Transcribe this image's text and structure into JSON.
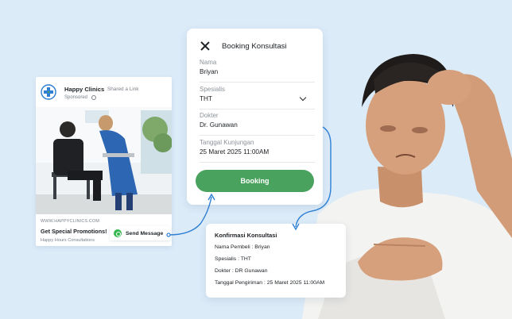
{
  "colors": {
    "background": "#dcebf8",
    "accent_green": "#4aa25f",
    "connector_blue": "#2f7fd4",
    "whatsapp_green": "#35b84f"
  },
  "ad": {
    "brand": "Happy Clinics",
    "shared": "Shared a Link",
    "sponsored": "Sponsored",
    "logo_icon": "medical-cross-icon",
    "globe_icon": "globe-icon",
    "url": "WWW.HAPPYCLINICS.COM",
    "promo": "Get Special Promotions!",
    "subtitle": "Happy Hours Consultations",
    "send_button": "Send Message",
    "send_icon": "whatsapp-icon"
  },
  "booking": {
    "title": "Booking Konsultasi",
    "close_icon": "close-icon",
    "fields": [
      {
        "label": "Nama",
        "value": "Briyan"
      },
      {
        "label": "Spesialis",
        "value": "THT"
      },
      {
        "label": "Dokter",
        "value": "Dr. Gunawan"
      },
      {
        "label": "Tanggal Kunjungan",
        "value": "25 Maret 2025 11:00AM"
      }
    ],
    "dropdown_icon": "chevron-down-icon",
    "submit": "Booking"
  },
  "confirmation": {
    "title": "Konfirmasi Konsultasi",
    "lines": [
      "Nama Pembeli : Briyan",
      "Spesialis : THT",
      "Dokter : DR Gunawan",
      "Tanggal Pengiriman : 25 Maret 2025 11:00AM"
    ]
  }
}
